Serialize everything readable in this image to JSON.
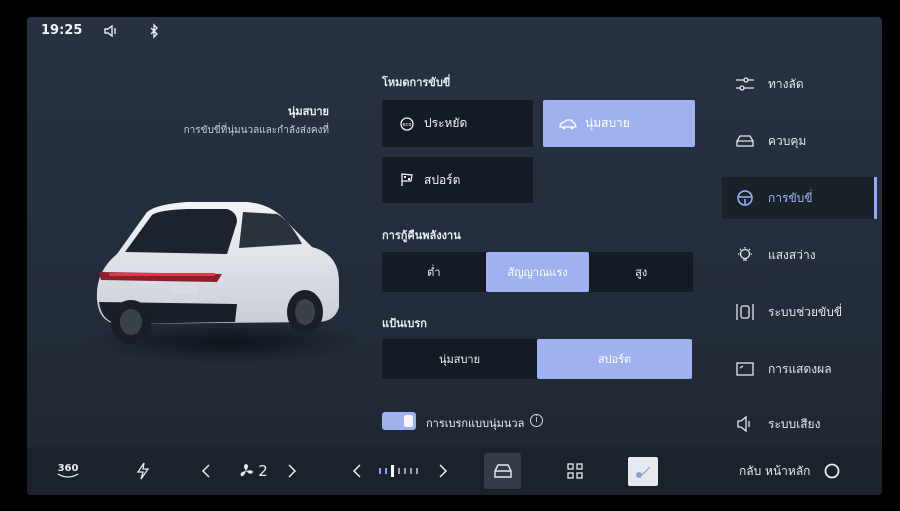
{
  "status": {
    "time": "19:25",
    "volume_icon": "speaker-icon",
    "bt_icon": "bluetooth-icon"
  },
  "left": {
    "mode_name": "นุ่มสบาย",
    "mode_desc": "การขับขี่ที่นุ่มนวลและกำลังส่งคงที่"
  },
  "drive_mode": {
    "label": "โหมดการขับขี่",
    "options": [
      {
        "label": "ประหยัด",
        "icon": "eco-icon",
        "active": false
      },
      {
        "label": "นุ่มสบาย",
        "icon": "comfort-car-icon",
        "active": true
      },
      {
        "label": "สปอร์ต",
        "icon": "sport-flag-icon",
        "active": false
      }
    ]
  },
  "regen": {
    "label": "การกู้คืนพลังงาน",
    "options": [
      "ต่ำ",
      "สัญญาณแรง",
      "สูง"
    ],
    "selected": "สัญญาณแรง"
  },
  "brake_pedal": {
    "label": "แป้นเบรก",
    "options": [
      "นุ่มสบาย",
      "สปอร์ต"
    ],
    "selected": "สปอร์ต"
  },
  "soft_brake": {
    "label": "การเบรกแบบนุ่มนวล",
    "enabled": true,
    "info": "i"
  },
  "menu": [
    {
      "label": "ทางลัด",
      "icon": "shortcut-sliders-icon",
      "active": false
    },
    {
      "label": "ควบคุม",
      "icon": "car-control-icon",
      "active": false
    },
    {
      "label": "การขับขี่",
      "icon": "steering-wheel-icon",
      "active": true
    },
    {
      "label": "แสงสว่าง",
      "icon": "light-bulb-icon",
      "active": false
    },
    {
      "label": "ระบบช่วยขับขี่",
      "icon": "driver-assist-icon",
      "active": false
    },
    {
      "label": "การแสดงผล",
      "icon": "display-icon",
      "active": false
    },
    {
      "label": "ระบบเสียง",
      "icon": "speaker-icon",
      "active": false
    }
  ],
  "bottom": {
    "cam360": "360",
    "fan_level": "2",
    "home_label": "กลับ หน้าหลัก"
  },
  "colors": {
    "accent": "#9fb2ef",
    "accent_text": "#9fb6ff",
    "tile_bg": "#141b24",
    "screen_bg": "#263040"
  }
}
